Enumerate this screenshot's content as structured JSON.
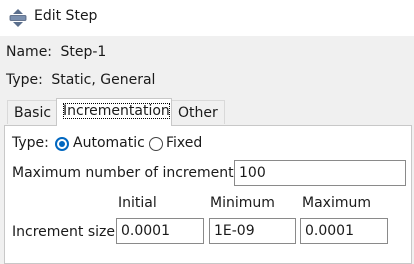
{
  "window": {
    "title": "Edit Step",
    "icon": "edit-step-icon"
  },
  "step": {
    "name_label": "Name:",
    "name_value": "Step-1",
    "type_label": "Type:",
    "type_value": "Static, General"
  },
  "tabs": [
    {
      "label": "Basic"
    },
    {
      "label": "Incrementation",
      "active": true
    },
    {
      "label": "Other"
    }
  ],
  "incrementation": {
    "type_label": "Type:",
    "type_options": [
      {
        "label": "Automatic",
        "selected": true
      },
      {
        "label": "Fixed",
        "selected": false
      }
    ],
    "max_increments_label": "Maximum number of increments:",
    "max_increments_value": "100",
    "columns": {
      "initial": "Initial",
      "minimum": "Minimum",
      "maximum": "Maximum"
    },
    "increment_size_label": "Increment size:",
    "increment_size": {
      "initial": "0.0001",
      "minimum": "1E-09",
      "maximum": "0.0001"
    }
  },
  "colors": {
    "accent": "#0067c0",
    "background": "#f0f0f0",
    "panel": "#ffffff"
  }
}
